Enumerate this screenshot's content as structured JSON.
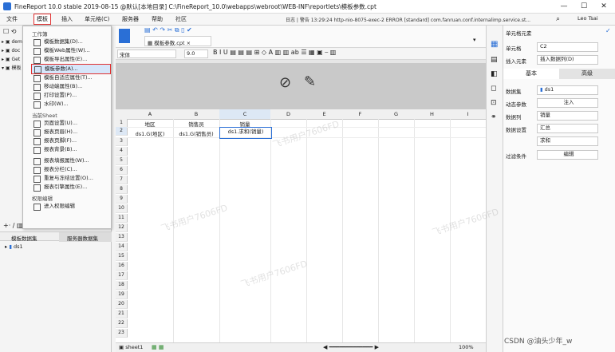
{
  "window": {
    "title": "FineReport 10.0 stable 2019-08-15 @默认[本地目录]   C:\\FineReport_10.0\\webapps\\webroot\\WEB-INF\\reportlets\\模板参数.cpt",
    "minimize": "—",
    "maximize": "☐",
    "close": "✕"
  },
  "menubar": {
    "items": [
      "文件",
      "模板",
      "插入",
      "单元格(C)",
      "服务器",
      "帮助",
      "社区"
    ],
    "log": "日志 | 警告 13:29:24 http-nio-8075-exec-2 ERROR [standard] com.fanruan.conf.internalimp.service.st...",
    "user": "Leo Tsai"
  },
  "sidebar": {
    "tree_items": [
      "dem",
      "doc",
      "Get",
      "模板"
    ],
    "bottom_tabs": [
      "模板数据集",
      "服务器数据集"
    ],
    "dataset": "ds1"
  },
  "template_menu": {
    "section_workbook": "工作簿",
    "workbook_items": [
      {
        "label": "模板数据集(D)..."
      },
      {
        "label": "模板Web属性(W)..."
      },
      {
        "label": "模板导出属性(E)..."
      },
      {
        "label": "模板参数(A)..."
      },
      {
        "label": "模板自适应属性(T)..."
      },
      {
        "label": "移动端属性(B)..."
      },
      {
        "label": "打印设置(P)..."
      },
      {
        "label": "水印(W)..."
      }
    ],
    "section_sheet": "当前Sheet",
    "sheet_items": [
      {
        "label": "页面设置(U)..."
      },
      {
        "label": "报表页眉(H)..."
      },
      {
        "label": "报表页脚(F)..."
      },
      {
        "label": "报表背景(B)..."
      },
      {
        "label": "报表填报属性(W)..."
      },
      {
        "label": "报表分栏(C)..."
      },
      {
        "label": "重复与冻结设置(O)..."
      },
      {
        "label": "报表引擎属性(E)..."
      }
    ],
    "section_perm": "权限编辑",
    "perm_item": "进入权限编辑"
  },
  "editor": {
    "tab_label": "模板参数.cpt ×",
    "font_name": "宋体",
    "font_size": "9.0"
  },
  "grid": {
    "columns": [
      "A",
      "B",
      "C",
      "D",
      "E",
      "F",
      "G",
      "H",
      "I"
    ],
    "rows": [
      "1",
      "2",
      "3",
      "4",
      "5",
      "6",
      "7",
      "8",
      "9",
      "10",
      "11",
      "12",
      "13",
      "14",
      "15",
      "16",
      "17",
      "18",
      "19",
      "20",
      "21",
      "22",
      "23"
    ],
    "r1": [
      "地区",
      "销售员",
      "销量"
    ],
    "r2": [
      "ds1.G(地区)",
      "ds1.G(销售员)",
      "ds1.求和(销量)"
    ],
    "sheet_tab": "sheet1",
    "zoom": "100%"
  },
  "props": {
    "header": "单元格元素",
    "cell_label": "单元格",
    "cell_value": "C2",
    "insert_label": "插入元素",
    "insert_value": "插入数据列(D)",
    "tab_basic": "基本",
    "tab_advanced": "高级",
    "dataset_label": "数据集",
    "dataset_value": "ds1",
    "dynparam_label": "动态参数",
    "dynparam_btn": "注入",
    "datacol_label": "数据列",
    "datacol_value": "销量",
    "dataset_setting_label": "数据设置",
    "agg_value": "汇总",
    "sum_value": "求和",
    "filter_label": "过滤条件",
    "filter_btn": "编辑"
  },
  "watermark": {
    "text": "飞书用户7606FD",
    "credit": "CSDN @油头少年_w"
  }
}
